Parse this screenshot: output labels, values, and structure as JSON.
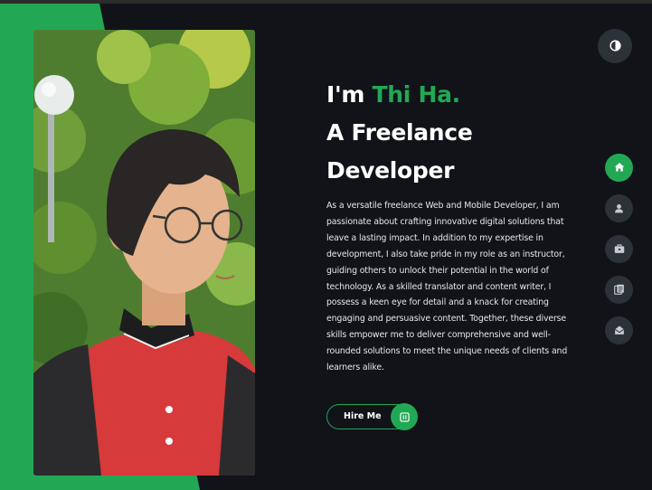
{
  "hero": {
    "greeting_prefix": "I'm ",
    "name": "Thi Ha.",
    "role_line1": "A Freelance",
    "role_line2": "Developer",
    "bio": "As a versatile freelance Web and Mobile Developer, I am passionate about crafting innovative digital solutions that leave a lasting impact. In addition to my expertise in development, I also take pride in my role as an instructor, guiding others to unlock their potential in the world of technology. As a skilled translator and content writer, I possess a keen eye for detail and a knack for creating engaging and persuasive content. Together, these diverse skills empower me to deliver comprehensive and well-rounded solutions to meet the unique needs of clients and learners alike.",
    "cta_label": "Hire Me"
  },
  "nav": {
    "theme_toggle_icon": "half-circle-icon",
    "items": [
      {
        "icon": "home-icon",
        "active": true
      },
      {
        "icon": "user-icon",
        "active": false
      },
      {
        "icon": "briefcase-icon",
        "active": false
      },
      {
        "icon": "documents-icon",
        "active": false
      },
      {
        "icon": "envelope-open-icon",
        "active": false
      }
    ]
  },
  "colors": {
    "accent": "#22a855",
    "background": "#111319",
    "nav_button": "#2d3138",
    "text": "#ffffff"
  }
}
